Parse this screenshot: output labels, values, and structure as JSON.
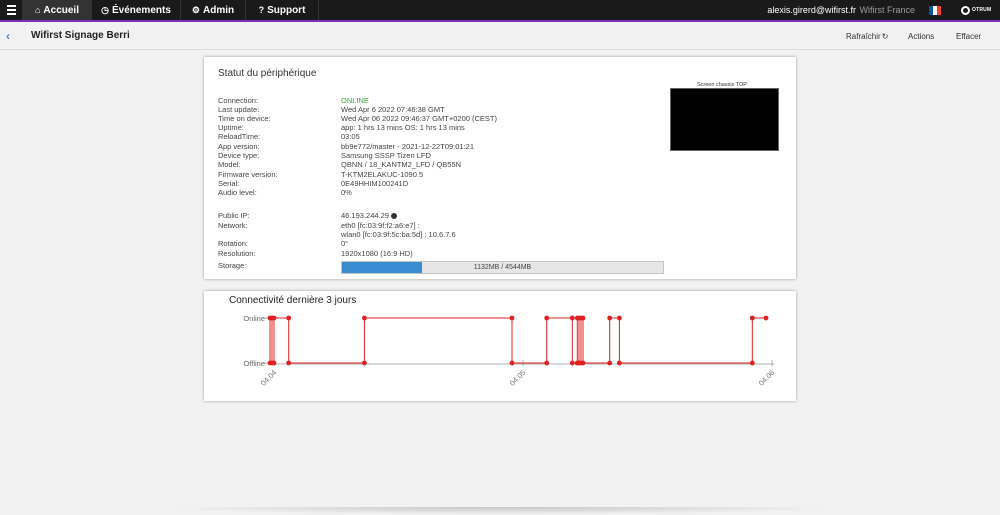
{
  "nav": {
    "items": [
      {
        "label": "Accueil",
        "icon": "home-icon"
      },
      {
        "label": "Événements",
        "icon": "clock-icon"
      },
      {
        "label": "Admin",
        "icon": "gears-icon"
      },
      {
        "label": "Support",
        "icon": "help-icon"
      }
    ],
    "user": "alexis.girerd@wifirst.fr",
    "org": "Wifirst France",
    "logo_text": "OTRUM",
    "accent": "#7b2fbf",
    "flag_colors": [
      "#0055a4",
      "#ffffff",
      "#ef4135"
    ]
  },
  "header": {
    "title": "Wifirst Signage Berri",
    "refresh_label": "Rafraîchir",
    "actions_label": "Actions",
    "clear_label": "Effacer"
  },
  "status": {
    "title": "Statut du périphérique",
    "rows": [
      {
        "label": "Connection:",
        "value": "ONLINE"
      },
      {
        "label": "Last update:",
        "value": "Wed Apr 6 2022 07:46:38 GMT"
      },
      {
        "label": "Time on device:",
        "value": "Wed Apr 06 2022 09:46:37 GMT+0200 (CEST)"
      },
      {
        "label": "Uptime:",
        "value": "app: 1 hrs 13 mins OS: 1 hrs 13 mins"
      },
      {
        "label": "ReloadTime:",
        "value": "03:05"
      },
      {
        "label": "App version:",
        "value": "bb9e772/master - 2021-12-22T09:01:21"
      },
      {
        "label": "Device type:",
        "value": "Samsung SSSP Tizen LFD"
      },
      {
        "label": "Model:",
        "value": "QBNN / 18_KANTM2_LFD / QB55N"
      },
      {
        "label": "Firmware version:",
        "value": "T-KTM2ELAKUC-1090.5"
      },
      {
        "label": "Serial:",
        "value": "0E49HHIM100241D"
      },
      {
        "label": "Audio level:",
        "value": "0%"
      },
      {
        "label": "Public IP:",
        "value": "46.193.244.29"
      },
      {
        "label": "Network:",
        "value": "eth0 [fc:03:9f:f2:a6:e7] :"
      },
      {
        "label": "",
        "value": "wlan0 [fc:03:9f:5c:ba:5d] : 10.6.7.6"
      },
      {
        "label": "Rotation:",
        "value": "0°"
      },
      {
        "label": "Resolution:",
        "value": "1920x1080 (16:9 HD)"
      },
      {
        "label": "Storage:",
        "value": ""
      }
    ],
    "storage": {
      "text": "1132MB / 4544MB",
      "used": 1132,
      "total": 4544,
      "color": "#3a8cd0"
    },
    "screen_label": "Screen chassis TOP"
  },
  "connectivity": {
    "title": "Connectivité dernière 3 jours",
    "chart_data": {
      "type": "line",
      "title": "",
      "y_categories": [
        "Offline",
        "Online"
      ],
      "x_ticks": [
        "04.04",
        "04.05",
        "04.06"
      ],
      "xlim": [
        0,
        2
      ],
      "color": "#e02020",
      "points": [
        {
          "x": -0.016,
          "y": 0
        },
        {
          "x": -0.016,
          "y": 1
        },
        {
          "x": -0.008,
          "y": 1
        },
        {
          "x": -0.008,
          "y": 0
        },
        {
          "x": 0,
          "y": 0
        },
        {
          "x": 0,
          "y": 1
        },
        {
          "x": 0.059,
          "y": 1
        },
        {
          "x": 0.059,
          "y": 0
        },
        {
          "x": 0.363,
          "y": 0
        },
        {
          "x": 0.363,
          "y": 1
        },
        {
          "x": 0.956,
          "y": 1
        },
        {
          "x": 0.956,
          "y": 0
        },
        {
          "x": 1.095,
          "y": 0
        },
        {
          "x": 1.095,
          "y": 1
        },
        {
          "x": 1.198,
          "y": 1
        },
        {
          "x": 1.198,
          "y": 0
        },
        {
          "x": 1.218,
          "y": 0
        },
        {
          "x": 1.218,
          "y": 1
        },
        {
          "x": 1.225,
          "y": 1
        },
        {
          "x": 1.225,
          "y": 0
        },
        {
          "x": 1.233,
          "y": 0
        },
        {
          "x": 1.233,
          "y": 1
        },
        {
          "x": 1.241,
          "y": 1
        },
        {
          "x": 1.241,
          "y": 0
        },
        {
          "x": 1.348,
          "y": 0
        },
        {
          "x": 1.348,
          "y": 1
        },
        {
          "x": 1.387,
          "y": 1
        },
        {
          "x": 1.387,
          "y": 0
        },
        {
          "x": 1.921,
          "y": 0
        },
        {
          "x": 1.921,
          "y": 1
        },
        {
          "x": 1.976,
          "y": 1
        }
      ]
    }
  }
}
